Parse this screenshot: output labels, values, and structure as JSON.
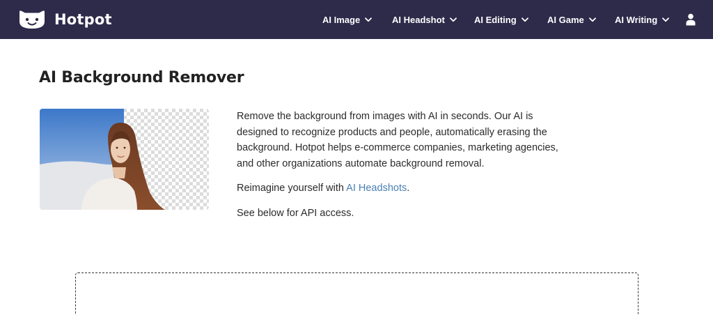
{
  "brand": {
    "name": "Hotpot"
  },
  "nav": {
    "items": [
      {
        "label": "AI Image"
      },
      {
        "label": "AI Headshot"
      },
      {
        "label": "AI Editing"
      },
      {
        "label": "AI Game"
      },
      {
        "label": "AI Writing"
      }
    ]
  },
  "page": {
    "title": "AI Background Remover",
    "paragraph1": "Remove the background from images with AI in seconds. Our AI is designed to recognize products and people, automatically erasing the background. Hotpot helps e-commerce companies, marketing agencies, and other organizations automate background removal.",
    "paragraph2_prefix": "Reimagine yourself with ",
    "paragraph2_link": "AI Headshots",
    "paragraph2_suffix": ".",
    "paragraph3": "See below for API access."
  },
  "colors": {
    "navbar": "#2e2a4a",
    "link": "#4a7fb5"
  }
}
